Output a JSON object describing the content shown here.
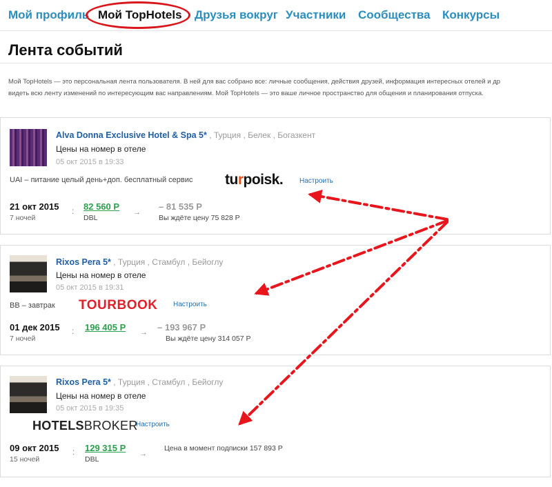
{
  "nav": {
    "items": [
      "Мой профиль",
      "Мой TopHotels",
      "Друзья вокруг",
      "Участники",
      "Сообщества",
      "Конкурсы"
    ]
  },
  "page_title": "Лента событий",
  "intro": {
    "line1": "Мой TopHotels — это персональная лента пользователя. В ней для вас собрано все: личные сообщения, действия друзей, информация интересных отелей и др",
    "line2": "видеть всю ленту изменений по интересующим вас направлениям. Мой TopHotels — это ваше личное пространство для общения и планирования отпуска."
  },
  "cards": [
    {
      "hotel": "Alva Donna Exclusive Hotel & Spa 5*",
      "location": ", Турция , Белек , Богазкент",
      "subtitle": "Цены на номер в отеле",
      "date": "05 окт 2015 в 19:33",
      "meal": "UAI – питание целый день+доп. бесплатный сервис",
      "logo_text": "tu",
      "logo_accent": "r",
      "logo_rest": "poisk.",
      "configure": "Настроить",
      "departure": "21 окт 2015",
      "nights": "7 ночей",
      "separator": ":",
      "price": "82 560 Р",
      "room": "DBL",
      "arrow": "→",
      "old_price": "– 81 535 Р",
      "wait_text": "Вы ждёте цену 75 828 Р"
    },
    {
      "hotel": "Rixos Pera 5*",
      "location": ", Турция , Стамбул , Бейоглу",
      "subtitle": "Цены на номер в отеле",
      "date": "05 окт 2015 в 19:31",
      "meal": "BB – завтрак",
      "logo_text": "TOURBOOK",
      "configure": "Настроить",
      "departure": "01 дек 2015",
      "nights": "7 ночей",
      "separator": ":",
      "price": "196 405 Р",
      "arrow": "→",
      "old_price": "– 193 967 Р",
      "wait_text": "Вы ждёте цену 314 057 Р"
    },
    {
      "hotel": "Rixos Pera 5*",
      "location": ", Турция , Стамбул , Бейоглу",
      "subtitle": "Цены на номер в отеле",
      "date": "05 окт 2015 в 19:35",
      "logo_bold": "HOTELS",
      "logo_rest": "BROKER",
      "configure": "Настроить",
      "departure": "09 окт 2015",
      "nights": "15 ночей",
      "separator": ":",
      "price": "129 315 Р",
      "room": "DBL",
      "arrow": "→",
      "wait_text": "Цена в момент подписки 157 893 Р"
    }
  ],
  "colors": {
    "link": "#2b8ec0",
    "price": "#2aa04c",
    "annotation": "#e8161c"
  }
}
